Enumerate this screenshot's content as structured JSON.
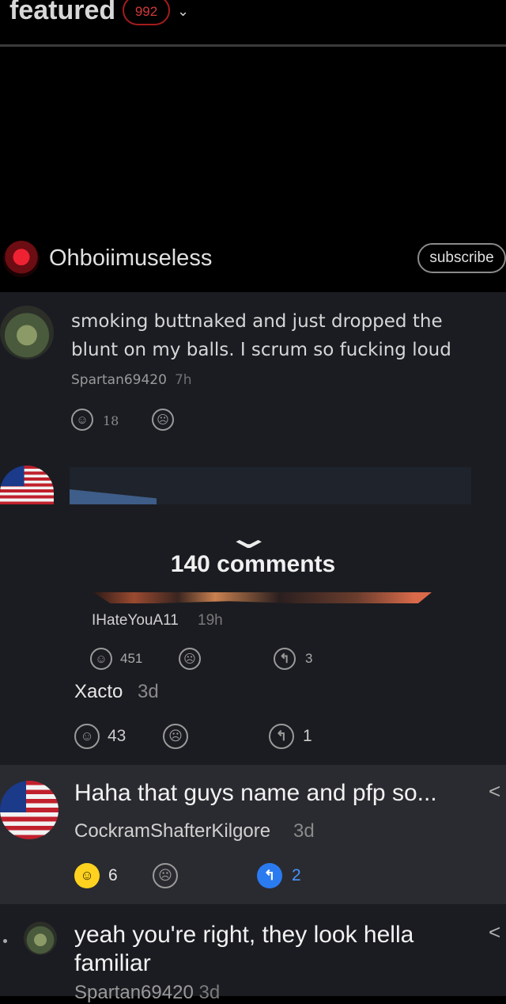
{
  "header": {
    "title": "featured",
    "badge": "992",
    "chevron": "⌄"
  },
  "post": {
    "poster_name": "Ohboiimuseless",
    "subscribe_label": "subscribe"
  },
  "background_comments": [
    {
      "text": "smoking buttnaked and just dropped the blunt on my balls. I scrum so fucking loud",
      "user": "Spartan69420",
      "time": "7h",
      "likes": "18"
    }
  ],
  "sheet": {
    "title": "140 comments",
    "comments": [
      {
        "user": "IHateYouA11",
        "time": "19h",
        "likes": "451",
        "replies": "3"
      },
      {
        "user": "Xacto",
        "time": "3d",
        "likes": "43",
        "replies": "1"
      },
      {
        "text": "Haha that guys name and pfp so...",
        "user": "CockramShafterKilgore",
        "time": "3d",
        "likes": "6",
        "replies": "2"
      },
      {
        "text": "yeah you're right, they look hella familiar",
        "user": "Spartan69420",
        "time": "3d"
      }
    ]
  },
  "icons": {
    "smile": "☺",
    "frown": "☹",
    "reply": "↰",
    "share": "<"
  },
  "colors": {
    "badge": "#a31c1c",
    "like_active": "#ffd21f",
    "reply_active": "#2a7bf0"
  }
}
